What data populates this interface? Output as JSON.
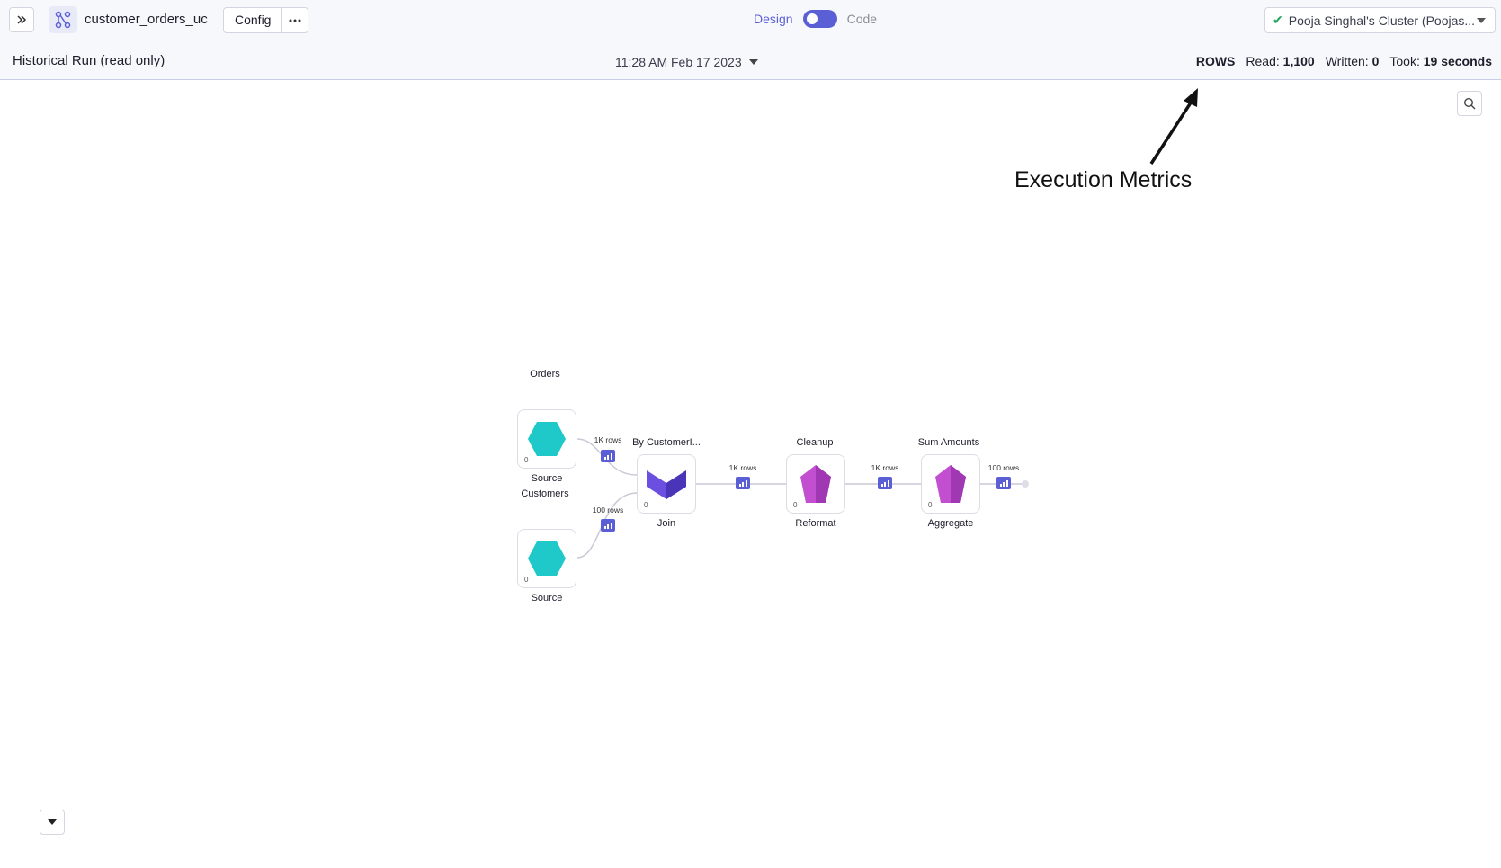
{
  "header": {
    "project_name": "customer_orders_uc",
    "config_label": "Config",
    "mode_design": "Design",
    "mode_code": "Code",
    "cluster_label": "Pooja Singhal's Cluster (Poojas..."
  },
  "run_bar": {
    "title": "Historical Run (read only)",
    "run_datetime": "11:28 AM Feb 17 2023",
    "rows_label": "ROWS",
    "read_label": "Read:",
    "read_value": "1,100",
    "written_label": "Written:",
    "written_value": "0",
    "took_label": "Took:",
    "took_value": "19 seconds"
  },
  "annotation": {
    "text": "Execution Metrics"
  },
  "pipeline": {
    "nodes": [
      {
        "title": "Orders",
        "type": "Source",
        "count": "0",
        "icon": "hexagon-source-icon",
        "color": "#20c9c9"
      },
      {
        "title": "Customers",
        "type": "Source",
        "count": "0",
        "icon": "hexagon-source-icon",
        "color": "#20c9c9"
      },
      {
        "title": "By CustomerI...",
        "type": "Join",
        "count": "0",
        "icon": "join-icon",
        "color": "#5b45d6"
      },
      {
        "title": "Cleanup",
        "type": "Reformat",
        "count": "0",
        "icon": "gem-transform-icon",
        "color": "#b440c4"
      },
      {
        "title": "Sum Amounts",
        "type": "Aggregate",
        "count": "0",
        "icon": "gem-transform-icon",
        "color": "#b440c4"
      }
    ],
    "edges": [
      {
        "label": "1K rows"
      },
      {
        "label": "100 rows"
      },
      {
        "label": "1K rows"
      },
      {
        "label": "1K rows"
      },
      {
        "label": "100 rows"
      }
    ]
  },
  "colors": {
    "accent": "#5b5fd6",
    "success": "#1fa65a",
    "source": "#20c9c9",
    "transform": "#b440c4"
  }
}
